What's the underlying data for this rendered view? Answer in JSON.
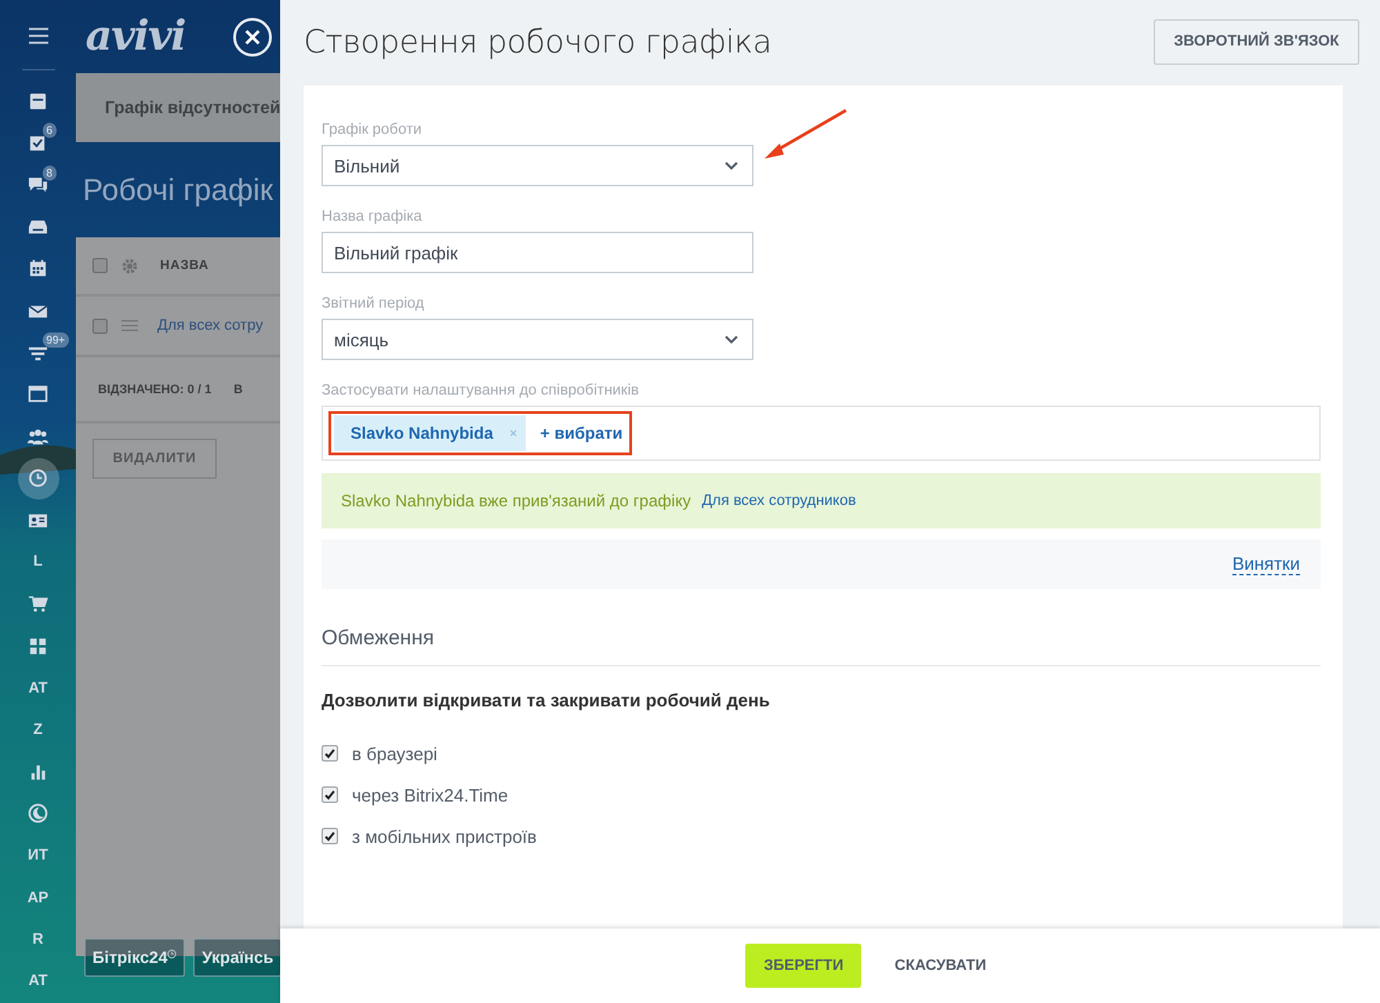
{
  "sidebar": {
    "items": [
      {
        "kind": "icon",
        "selected": false
      },
      {
        "kind": "icon",
        "selected": false,
        "badge": "6"
      },
      {
        "kind": "icon",
        "selected": false,
        "badge": "8"
      },
      {
        "kind": "icon",
        "selected": false
      },
      {
        "kind": "icon",
        "selected": false
      },
      {
        "kind": "icon",
        "selected": false
      },
      {
        "kind": "icon",
        "selected": false,
        "badge": "99+"
      },
      {
        "kind": "icon",
        "selected": false
      },
      {
        "kind": "icon",
        "selected": false
      },
      {
        "kind": "icon",
        "selected": true
      },
      {
        "kind": "icon",
        "selected": false
      },
      {
        "kind": "text",
        "label": "L",
        "selected": false
      },
      {
        "kind": "icon",
        "selected": false
      },
      {
        "kind": "icon",
        "selected": false
      },
      {
        "kind": "text",
        "label": "AT",
        "selected": false
      },
      {
        "kind": "text",
        "label": "Z",
        "selected": false
      },
      {
        "kind": "icon",
        "selected": false
      },
      {
        "kind": "icon",
        "selected": false
      },
      {
        "kind": "text",
        "label": "ИТ",
        "selected": false
      },
      {
        "kind": "text",
        "label": "AP",
        "selected": false
      },
      {
        "kind": "text",
        "label": "R",
        "selected": false
      },
      {
        "kind": "text",
        "label": "AT",
        "selected": false
      }
    ]
  },
  "background_page": {
    "logo": "avivi",
    "tab": "Графік відсутностей",
    "title": "Робочі графік",
    "table": {
      "select_all_checked": false,
      "header": "НАЗВА",
      "rows": [
        {
          "name": "Для всех сотру",
          "checked": false
        }
      ],
      "selected_count": "ВІДЗНАЧЕНО: 0 / 1",
      "column_2": "В"
    },
    "delete_button": "ВИДАЛИТИ",
    "footer_buttons": [
      "Бітрікс24",
      "Українсь"
    ]
  },
  "panel": {
    "title": "Створення робочого графіка",
    "feedback_button": "ЗВОРОТНИЙ ЗВ'ЯЗОК",
    "fields": [
      {
        "kind": "select",
        "label": "Графік роботи",
        "value": "Вільний"
      },
      {
        "kind": "input",
        "label": "Назва графіка",
        "value": "Вільний графік"
      },
      {
        "kind": "select",
        "label": "Звітний період",
        "value": "місяць"
      }
    ],
    "employees": {
      "label": "Застосувати налаштування до співробітників",
      "tags": [
        {
          "name": "Slavko Nahnybida"
        }
      ],
      "add_link": "+ вибрати"
    },
    "notice": {
      "text": "Slavko Nahnybida вже прив'язаний до графіку",
      "link": "Для всех сотрудников"
    },
    "exceptions_link": "Винятки",
    "restrictions": {
      "title": "Обмеження",
      "heading": "Дозволити відкривати та закривати робочий день",
      "options": [
        {
          "label": "в браузері",
          "checked": true
        },
        {
          "label": "через Bitrix24.Time",
          "checked": true
        },
        {
          "label": "з мобільних пристроїв",
          "checked": true
        }
      ]
    },
    "footer": {
      "save": "ЗБЕРЕГТИ",
      "cancel": "СКАСУВАТИ"
    }
  }
}
